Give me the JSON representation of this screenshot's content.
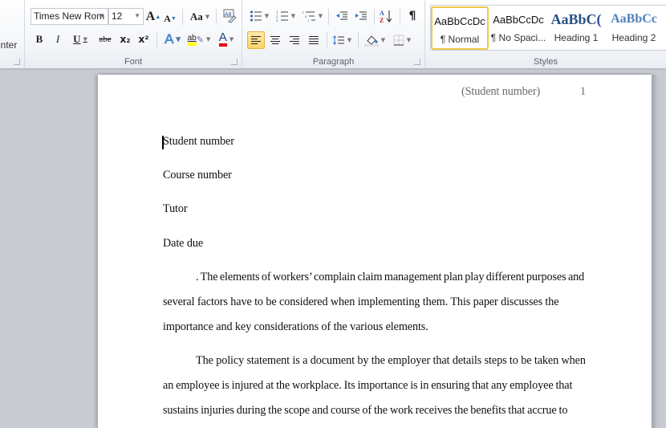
{
  "clipboard": {
    "format_painter_label": "inter"
  },
  "font_group": {
    "label": "Font",
    "font_name": "Times New Rom",
    "font_size": "12",
    "grow_font": "A",
    "shrink_font": "A",
    "change_case": "Aa",
    "clear_formatting": "clear-formatting-icon",
    "bold": "B",
    "italic": "I",
    "underline": "U",
    "strikethrough": "abe",
    "subscript": "x₂",
    "superscript": "x²",
    "text_effects": "A",
    "highlight": "ab",
    "font_color": "A",
    "highlight_color": "#ffff00",
    "font_color_value": "#e00000"
  },
  "paragraph_group": {
    "label": "Paragraph",
    "bullets": "bullets-icon",
    "numbering": "numbering-icon",
    "multilevel": "multilevel-list-icon",
    "decrease_indent": "decrease-indent-icon",
    "increase_indent": "increase-indent-icon",
    "sort": "sort-icon",
    "show_hide": "¶",
    "align_left_active": true
  },
  "styles_group": {
    "label": "Styles",
    "items": [
      {
        "preview": "AaBbCcDc",
        "name": "¶ Normal",
        "selected": true
      },
      {
        "preview": "AaBbCcDc",
        "name": "¶ No Spaci...",
        "selected": false
      },
      {
        "preview": "AaBbC(",
        "name": "Heading 1",
        "selected": false
      },
      {
        "preview": "AaBbCc",
        "name": "Heading 2",
        "selected": false
      }
    ]
  },
  "document": {
    "header": {
      "running_head": "(Student number)",
      "page_number": "1"
    },
    "lines": [
      "Student number",
      "Course number",
      "Tutor",
      "Date due"
    ],
    "paragraphs": [
      {
        "lines": [
          ". The elements of workers’ complain claim management plan play different purposes and",
          "several factors have to be considered when implementing them. This paper discusses the",
          "importance and key considerations of the various elements."
        ]
      },
      {
        "lines": [
          "The policy statement is a document by the employer that details steps to be taken when",
          "an employee is injured at the workplace. Its importance is in ensuring that any employee that",
          "sustains injuries during the scope and course of the work receives the benefits that accrue to"
        ]
      }
    ]
  }
}
